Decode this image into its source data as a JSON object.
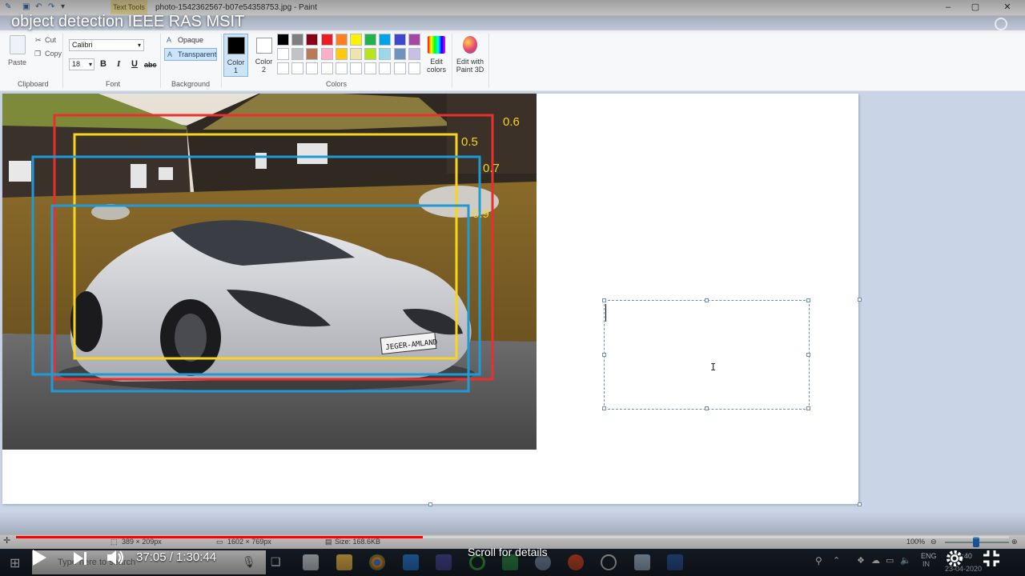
{
  "video": {
    "title": "object detection IEEE RAS MSIT",
    "time_display": "37:05 / 1:30:44",
    "scroll_hint": "Scroll for details",
    "progress_percent": 41
  },
  "window": {
    "context_tab": "Text Tools",
    "title": "photo-1542362567-b07e54358753.jpg - Paint"
  },
  "ribbon": {
    "clipboard": {
      "paste": "Paste",
      "cut": "Cut",
      "copy": "Copy",
      "label": "Clipboard"
    },
    "font": {
      "name": "Calibri",
      "size": "18",
      "bold": "B",
      "italic": "I",
      "underline": "U",
      "strike": "abc",
      "label": "Font"
    },
    "background": {
      "opaque": "Opaque",
      "transparent": "Transparent",
      "label": "Background"
    },
    "color1": {
      "line1": "Color",
      "line2": "1"
    },
    "color2": {
      "line1": "Color",
      "line2": "2"
    },
    "colors_label": "Colors",
    "edit_colors": {
      "line1": "Edit",
      "line2": "colors"
    },
    "paint3d": {
      "line1": "Edit with",
      "line2": "Paint 3D"
    },
    "palette_row1": [
      "#000000",
      "#7f7f7f",
      "#880015",
      "#ed1c24",
      "#ff7f27",
      "#fff200",
      "#22b14c",
      "#00a2e8",
      "#3f48cc",
      "#a349a4"
    ],
    "palette_row2": [
      "#ffffff",
      "#c3c3c3",
      "#b97a57",
      "#ffaec9",
      "#ffc90e",
      "#efe4b0",
      "#b5e61d",
      "#99d9ea",
      "#7092be",
      "#c8bfe7"
    ]
  },
  "boxes": [
    {
      "score": "0.6",
      "color": "#e8302e"
    },
    {
      "score": "0.5",
      "color": "#f7d51d"
    },
    {
      "score": "0.7",
      "color": "#1e9bd7"
    },
    {
      "score": "0.9",
      "color": "#1e9bd7"
    }
  ],
  "plate": "JEGER-AMLAND",
  "status": {
    "selection": "389 × 209px",
    "image_size": "1602 × 769px",
    "file_size": "Size: 168.6KB",
    "zoom": "100%"
  },
  "taskbar": {
    "search_placeholder": "Type here to search",
    "lang_top": "ENG",
    "lang_bottom": "IN",
    "time": "11:40",
    "date": "23-04-2020"
  }
}
